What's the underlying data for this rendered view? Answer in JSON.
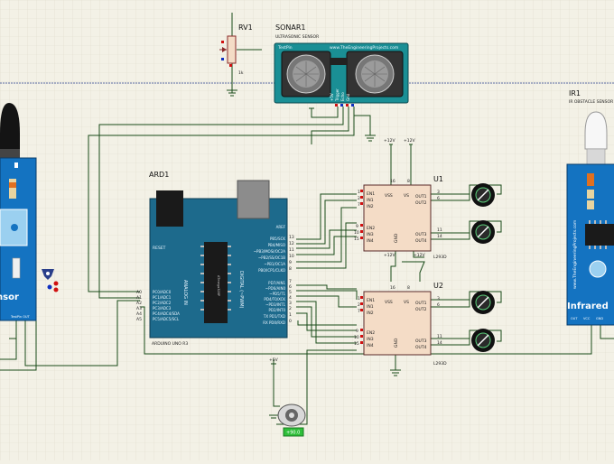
{
  "colors": {
    "background": "#f3f1e6",
    "grid": "#e0dccb",
    "wire": "#184a18",
    "arduino_board": "#1d6a8c",
    "sensor_board": "#1473c1",
    "sonar_board": "#1a8f95",
    "chip": "#f4dcc6",
    "pin_red": "#d01010",
    "pin_blue": "#1030c0",
    "value_box": "#2fbf3a"
  },
  "sonar": {
    "ref": "SONAR1",
    "type": "ULTRASONIC SENSOR",
    "brand": "TestPin",
    "site": "www.TheEngineeringProjects.com",
    "pins": [
      "+5V",
      "Trigger",
      "Echo",
      "Gnd"
    ]
  },
  "pot": {
    "ref": "RV1",
    "value": "1k"
  },
  "arduino": {
    "ref": "ARD1",
    "model": "ARDUINO UNO R3",
    "side_label": "ANALOG IN",
    "digital_label": "DIGITAL (~PWM)",
    "chip_label": "ATmega328P",
    "left_labels": [
      "RESET",
      "PC0/ADC0",
      "PC1/ADC1",
      "PC2/ADC2",
      "PC3/ADC3",
      "PC4/ADC4/SDA",
      "PC5/ADC5/SCL"
    ],
    "analog_pins": [
      "A0",
      "A1",
      "A2",
      "A3",
      "A4",
      "A5"
    ],
    "right_labels": [
      "AREF",
      "PB5/SCK",
      "PB4/MISO",
      "~PB3/MOSI/OC2A",
      "~PB2/SS/OC1B",
      "~PB1/OC1A",
      "PB0/ICP1/CLKO",
      "PD7/AIN1",
      "~PD6/AIN0",
      "~PD5/T1",
      "PD4/T0/XCK",
      "~PD3/INT1",
      "PD2/INT0",
      "TX PD1/TXD",
      "RX PD0/RXD"
    ],
    "right_pins": [
      "13",
      "12",
      "11",
      "10",
      "9",
      "8",
      "7",
      "6",
      "5",
      "4",
      "3",
      "2",
      "1",
      "0"
    ]
  },
  "drivers": [
    {
      "ref": "U1",
      "model": "L293D",
      "left_pins": [
        "EN1",
        "IN1",
        "IN2",
        "EN2",
        "IN3",
        "IN4"
      ],
      "left_nums": [
        "1",
        "2",
        "7",
        "9",
        "10",
        "15"
      ],
      "right_pins": [
        "OUT1",
        "OUT2",
        "OUT3",
        "OUT4"
      ],
      "right_nums": [
        "3",
        "6",
        "11",
        "14"
      ],
      "top_pins": [
        "VSS",
        "VS"
      ],
      "top_nums": [
        "16",
        "8"
      ],
      "bottom": "GND"
    },
    {
      "ref": "U2",
      "model": "L293D",
      "left_pins": [
        "EN1",
        "IN1",
        "IN2",
        "EN2",
        "IN3",
        "IN4"
      ],
      "left_nums": [
        "1",
        "2",
        "7",
        "9",
        "10",
        "15"
      ],
      "right_pins": [
        "OUT1",
        "OUT2",
        "OUT3",
        "OUT4"
      ],
      "right_nums": [
        "3",
        "6",
        "11",
        "14"
      ],
      "top_pins": [
        "VSS",
        "VS"
      ],
      "top_nums": [
        "16",
        "8"
      ],
      "bottom": "GND"
    }
  ],
  "supplies": [
    "+12V",
    "+12V",
    "+12V",
    "+12V",
    "+5V"
  ],
  "ir": {
    "ref": "IR1",
    "type": "IR OBSTACLE SENSOR",
    "site": "www.TheEngineeringProjects.com",
    "name": "Infrared",
    "pins": [
      "OUT",
      "VCC",
      "GND"
    ]
  },
  "left_sensor": {
    "name": "nsor",
    "pins": "TestPin OUT"
  },
  "servo": {
    "value": "+90.0"
  }
}
